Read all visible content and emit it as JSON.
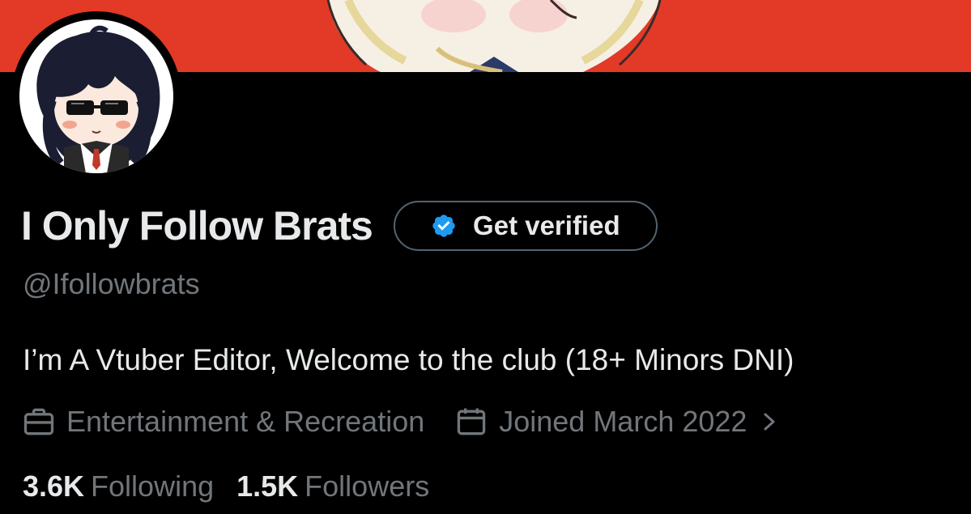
{
  "profile": {
    "display_name": "I Only Follow Brats",
    "verify_button_label": "Get verified",
    "handle": "@Ifollowbrats",
    "bio": "I’m A Vtuber Editor, Welcome to the club (18+ Minors DNI)",
    "category": "Entertainment & Recreation",
    "joined": "Joined March 2022",
    "following_count": "3.6K",
    "following_label": "Following",
    "followers_count": "1.5K",
    "followers_label": "Followers"
  },
  "icons": {
    "verified_badge": "verified-badge-icon",
    "category": "briefcase-icon",
    "joined": "calendar-icon",
    "expand": "chevron-right-icon"
  },
  "colors": {
    "banner": "#e23a26",
    "background": "#000000",
    "primary_text": "#e7e9ea",
    "secondary_text": "#71767b",
    "verified_blue": "#1d9bf0",
    "button_border": "#536471"
  }
}
